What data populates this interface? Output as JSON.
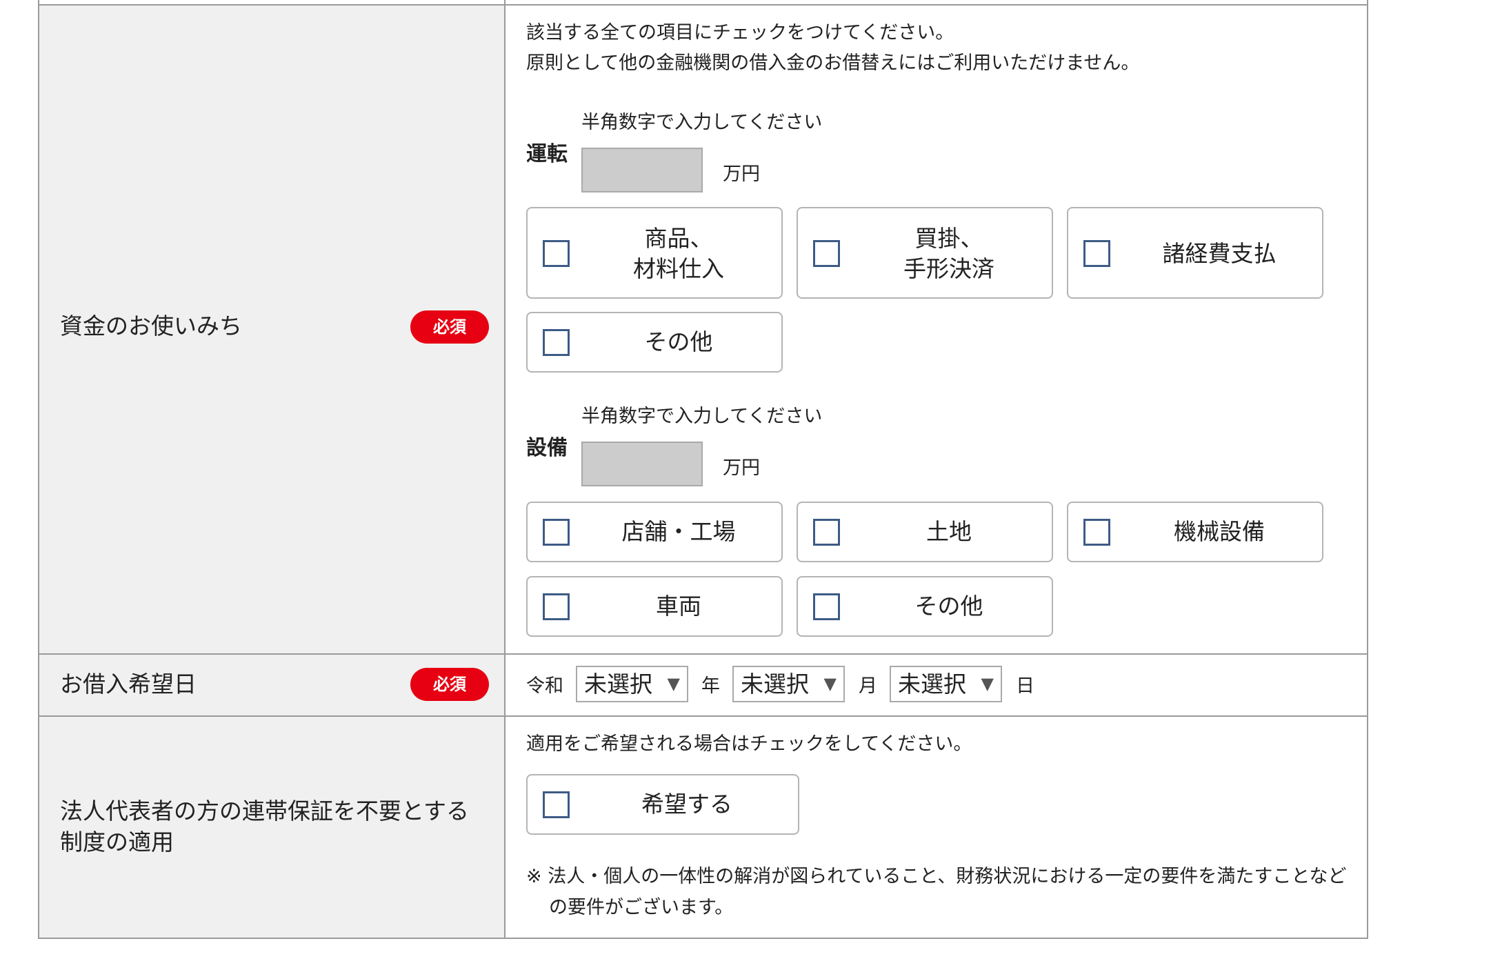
{
  "purpose": {
    "label": "資金のお使いみち",
    "required_badge": "必須",
    "instruction_line1": "該当する全ての項目にチェックをつけてください。",
    "instruction_line2": "原則として他の金融機関の借入金のお借替えにはご利用いただけません。",
    "operating": {
      "label": "運転",
      "hint": "半角数字で入力してください",
      "amount_value": "",
      "unit": "万円",
      "options": [
        {
          "line1": "商品、",
          "line2": "材料仕入",
          "checked": false
        },
        {
          "line1": "買掛、",
          "line2": "手形決済",
          "checked": false
        },
        {
          "line1": "諸経費支払",
          "line2": "",
          "checked": false
        },
        {
          "line1": "その他",
          "line2": "",
          "checked": false
        }
      ]
    },
    "equipment": {
      "label": "設備",
      "hint": "半角数字で入力してください",
      "amount_value": "",
      "unit": "万円",
      "options": [
        {
          "label": "店舗・工場",
          "checked": false
        },
        {
          "label": "土地",
          "checked": false
        },
        {
          "label": "機械設備",
          "checked": false
        },
        {
          "label": "車両",
          "checked": false
        },
        {
          "label": "その他",
          "checked": false
        }
      ]
    }
  },
  "borrow_date": {
    "label": "お借入希望日",
    "required_badge": "必須",
    "era": "令和",
    "year_select": "未選択",
    "year_unit": "年",
    "month_select": "未選択",
    "month_unit": "月",
    "day_select": "未選択",
    "day_unit": "日",
    "arrow": "▼"
  },
  "guarantee": {
    "label_line1": "法人代表者の方の連帯保証を不要とする",
    "label_line2": "制度の適用",
    "instruction": "適用をご希望される場合はチェックをしてください。",
    "option_label": "希望する",
    "checked": false,
    "note_line1": "※ 法人・個人の一体性の解消が図られていること、財務状況における一定の要件を満たすことなど",
    "note_line2": "の要件がございます。"
  },
  "colors": {
    "badge": "#e60012",
    "checkbox_border": "#3d5b85",
    "label_bg": "#f0f0f0",
    "input_bg": "#cccccc"
  }
}
